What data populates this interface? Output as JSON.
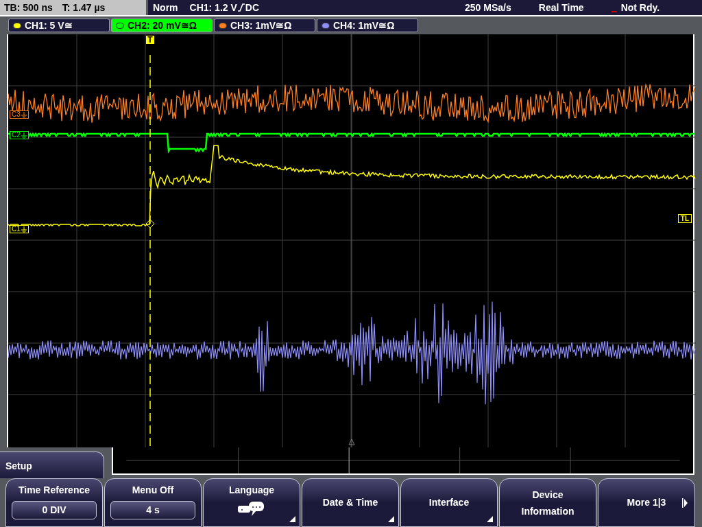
{
  "header": {
    "timebase": "TB: 500 ns",
    "trigger_time": "T: 1.47 µs",
    "mode": "Norm",
    "trigger_level": "CH1: 1.2 V",
    "trigger_coupling": "DC",
    "sample_rate": "250 MSa/s",
    "acquisition": "Real Time",
    "status": "Not Rdy."
  },
  "channels": [
    {
      "label": "CH1: 5 V≅",
      "selected": false,
      "color": "#ffff00"
    },
    {
      "label": "CH2: 20 mV≅Ω",
      "selected": true,
      "color": "#00ff00"
    },
    {
      "label": "CH3: 1mV≅Ω",
      "selected": false,
      "color": "#ff7f1f"
    },
    {
      "label": "CH4: 1mV≅Ω",
      "selected": false,
      "color": "#8f8fff"
    }
  ],
  "markers": [
    {
      "label": "C3",
      "color": "#ff7f1f"
    },
    {
      "label": "C2",
      "color": "#00ff00"
    },
    {
      "label": "C1",
      "color": "#ffff00"
    }
  ],
  "trigger_marker": "T",
  "trigger_level_marker": "TL",
  "menu_title": "Setup",
  "softkeys": [
    {
      "kind": "value",
      "label": "Time Reference",
      "value": "0 DIV"
    },
    {
      "kind": "value",
      "label": "Menu Off",
      "value": "4 s"
    },
    {
      "kind": "icon",
      "label": "Language"
    },
    {
      "kind": "submenu",
      "label": "Date & Time"
    },
    {
      "kind": "submenu",
      "label": "Interface"
    },
    {
      "kind": "plain",
      "label": "Device Information"
    },
    {
      "kind": "next",
      "label": "More 1|3"
    }
  ]
}
